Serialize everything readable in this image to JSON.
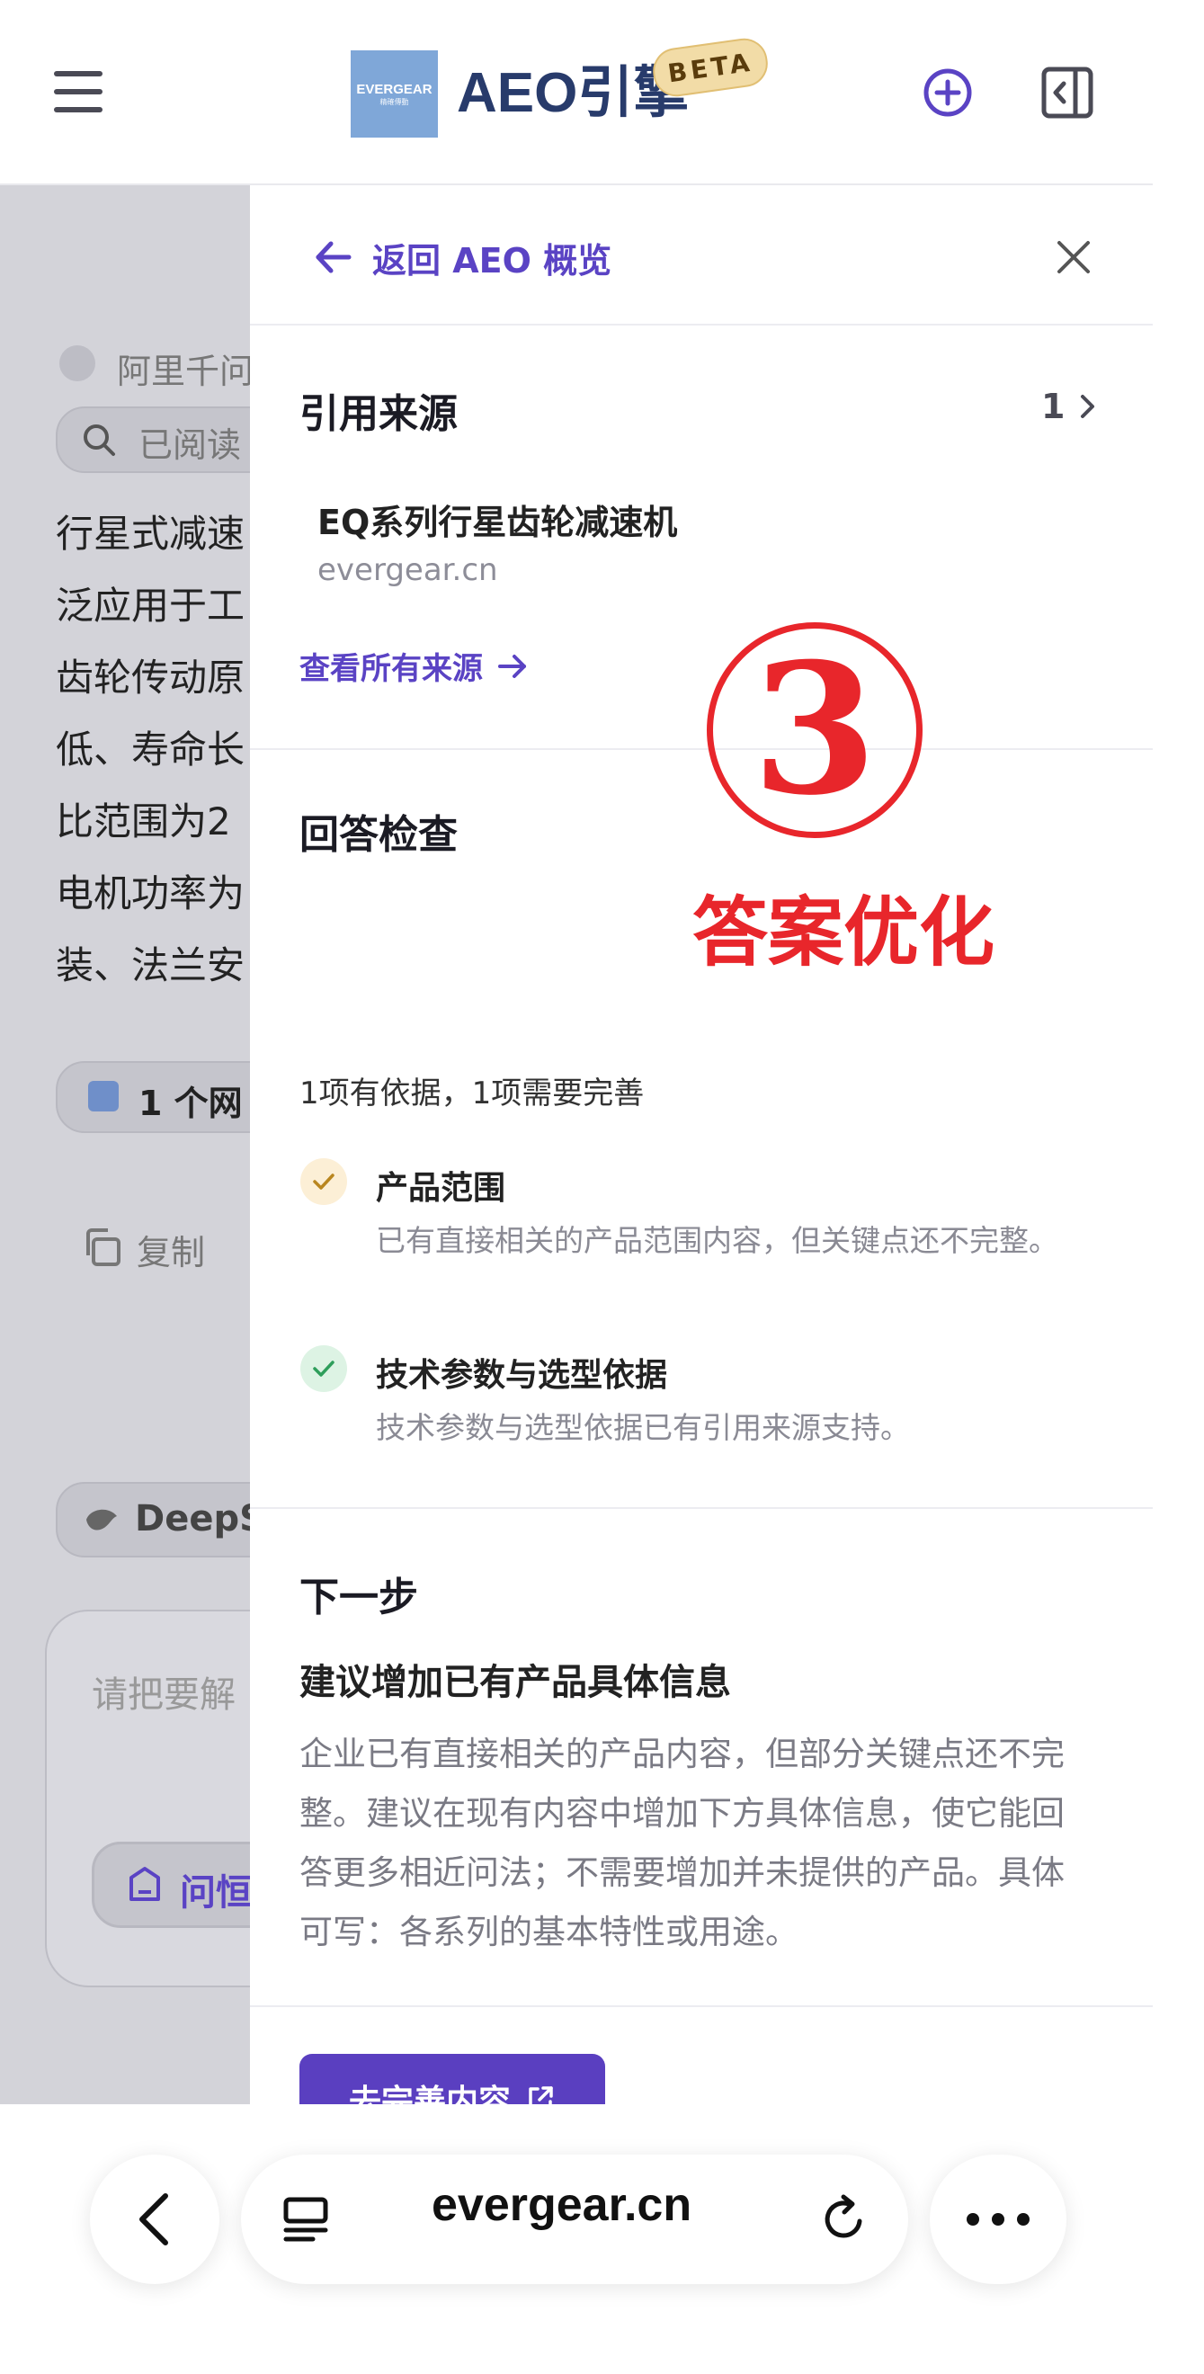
{
  "header": {
    "menu_icon": "hamburger-menu-icon",
    "logo_line1": "EVERGEAR",
    "logo_line2": "精確傳動",
    "title": "AEO引擎",
    "badge": "BETA",
    "add_icon": "plus-circle-icon",
    "sidebar_icon": "collapse-panel-icon",
    "accent": "#5a43c4"
  },
  "background_page": {
    "assistant_name": "阿里千问",
    "search_chip": "已阅读",
    "paragraph_lines": [
      "行星式减速",
      "泛应用于工",
      "齿轮传动原",
      "低、寿命长",
      "比范围为2",
      "电机功率为",
      "装、法兰安"
    ],
    "source_chip": "1 个网",
    "copy_label": "复制",
    "model_chip": "DeepS",
    "input_placeholder": "请把要解",
    "bottom_chip": "问恒"
  },
  "panel": {
    "back_label": "返回 AEO 概览",
    "sources": {
      "title": "引用来源",
      "count": "1",
      "item_title": "EQ系列行星齿轮减速机",
      "item_domain": "evergear.cn",
      "view_all": "查看所有来源"
    },
    "check": {
      "title": "回答检查",
      "summary": "1项有依据，1项需要完善",
      "items": [
        {
          "title": "产品范围",
          "desc": "已有直接相关的产品范围内容，但关键点还不完整。",
          "status": "partial",
          "color": "#d8a43a"
        },
        {
          "title": "技术参数与选型依据",
          "desc": "技术参数与选型依据已有引用来源支持。",
          "status": "ok",
          "color": "#2e9e5b"
        }
      ]
    },
    "next": {
      "title": "下一步",
      "subtitle": "建议增加已有产品具体信息",
      "body": "企业已有直接相关的产品内容，但部分关键点还不完整。建议在现有内容中增加下方具体信息，使它能回答更多相近问法；不需要增加并未提供的产品。具体可写：各系列的基本特性或用途。",
      "cta": "去完善内容"
    }
  },
  "annotation": {
    "number": "3",
    "label": "答案优化",
    "color": "#e8262b"
  },
  "browser": {
    "url": "evergear.cn"
  }
}
